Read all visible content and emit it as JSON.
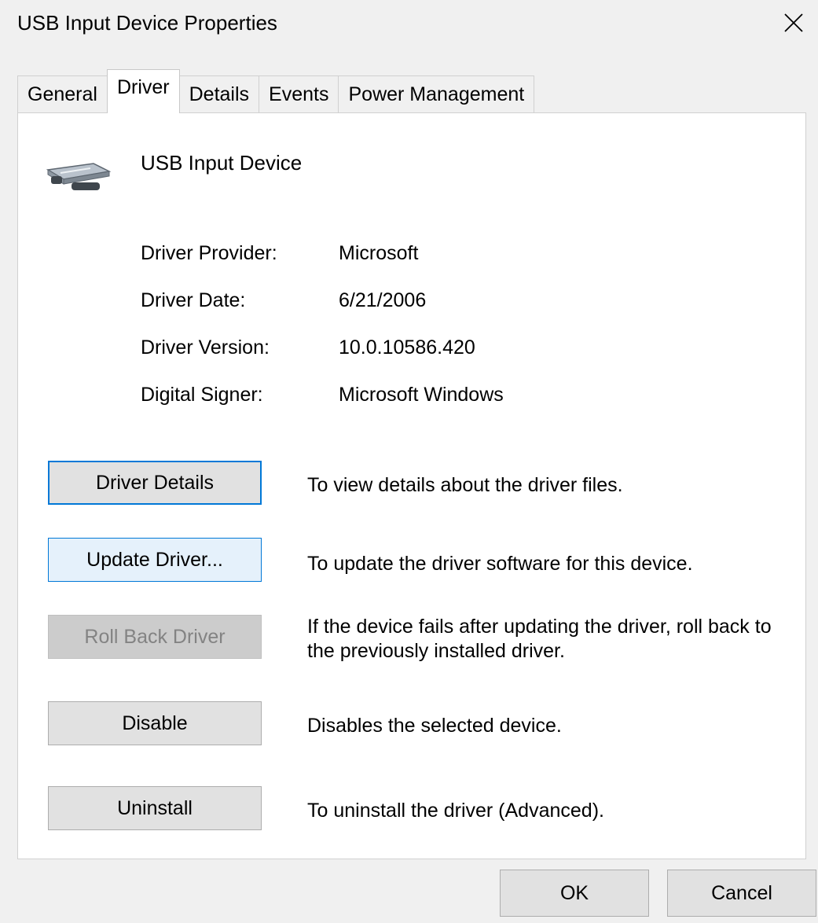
{
  "window": {
    "title": "USB Input Device Properties",
    "close_icon": "close-icon"
  },
  "tabs": [
    {
      "label": "General",
      "active": false
    },
    {
      "label": "Driver",
      "active": true
    },
    {
      "label": "Details",
      "active": false
    },
    {
      "label": "Events",
      "active": false
    },
    {
      "label": "Power Management",
      "active": false
    }
  ],
  "device": {
    "icon": "usb-device-icon",
    "name": "USB Input Device"
  },
  "driver_info": [
    {
      "label": "Driver Provider:",
      "value": "Microsoft"
    },
    {
      "label": "Driver Date:",
      "value": "6/21/2006"
    },
    {
      "label": "Driver Version:",
      "value": "10.0.10586.420"
    },
    {
      "label": "Digital Signer:",
      "value": "Microsoft Windows"
    }
  ],
  "actions": [
    {
      "label": "Driver Details",
      "description": "To view details about the driver files.",
      "state": "focused"
    },
    {
      "label": "Update Driver...",
      "description": "To update the driver software for this device.",
      "state": "hover"
    },
    {
      "label": "Roll Back Driver",
      "description": "If the device fails after updating the driver, roll back to the previously installed driver.",
      "state": "disabled"
    },
    {
      "label": "Disable",
      "description": "Disables the selected device.",
      "state": "normal"
    },
    {
      "label": "Uninstall",
      "description": "To uninstall the driver (Advanced).",
      "state": "normal"
    }
  ],
  "footer": {
    "ok_label": "OK",
    "cancel_label": "Cancel"
  },
  "colors": {
    "background": "#f0f0f0",
    "panel": "#ffffff",
    "focus_border": "#0078d7",
    "button_face": "#e1e1e1",
    "disabled_text": "#838383"
  }
}
